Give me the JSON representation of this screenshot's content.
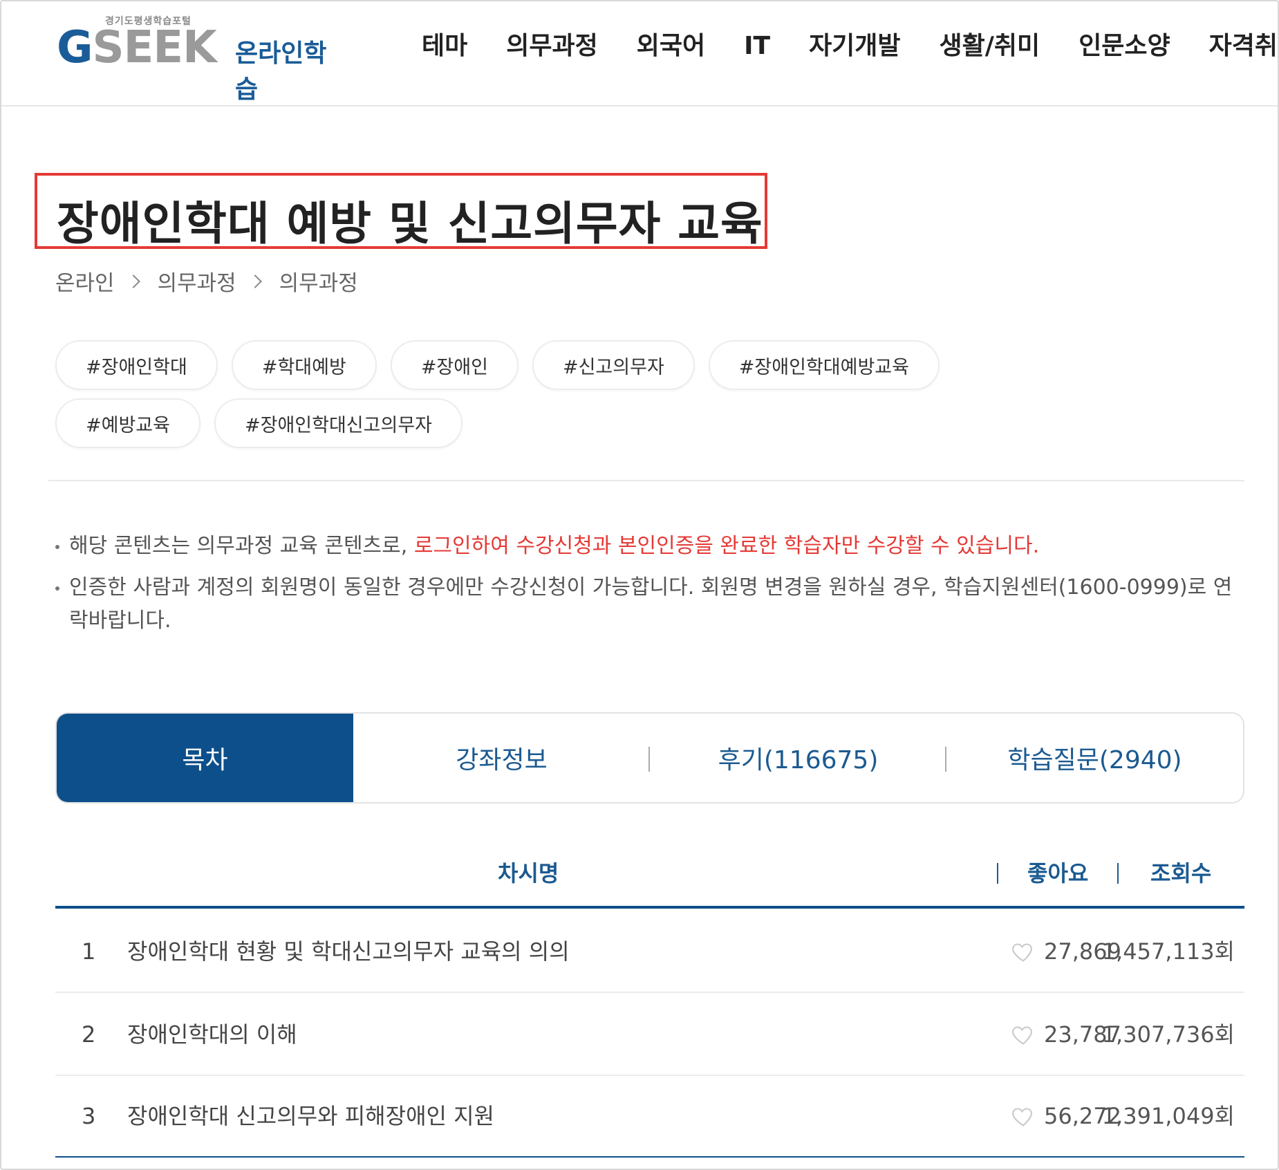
{
  "header": {
    "logo_sub": "경기도평생학습포털",
    "logo_g": "G",
    "logo_rest": "SEEK",
    "logo_online": "온라인학습",
    "nav": [
      "테마",
      "의무과정",
      "외국어",
      "IT",
      "자기개발",
      "생활/취미",
      "인문소양",
      "자격취득"
    ]
  },
  "page": {
    "title": "장애인학대 예방 및 신고의무자 교육",
    "breadcrumb": [
      "온라인",
      "의무과정",
      "의무과정"
    ]
  },
  "tags": [
    "#장애인학대",
    "#학대예방",
    "#장애인",
    "#신고의무자",
    "#장애인학대예방교육",
    "#예방교육",
    "#장애인학대신고의무자"
  ],
  "notices": {
    "first_plain": "해당 콘텐츠는 의무과정 교육 콘텐츠로, ",
    "first_red": "로그인하여 수강신청과 본인인증을 완료한 학습자만 수강할 수 있습니다.",
    "second": "인증한 사람과 계정의 회원명이 동일한 경우에만 수강신청이 가능합니다. 회원명 변경을 원하실 경우, 학습지원센터(1600-0999)로 연락바랍니다."
  },
  "tabs": [
    "목차",
    "강좌정보",
    "후기(116675)",
    "학습질문(2940)"
  ],
  "table": {
    "headers": {
      "title": "차시명",
      "likes": "좋아요",
      "views": "조회수"
    },
    "rows": [
      {
        "num": "1",
        "title": "장애인학대 현황 및 학대신고의무자 교육의 의의",
        "likes": "27,869",
        "views": "1,457,113회"
      },
      {
        "num": "2",
        "title": "장애인학대의 이해",
        "likes": "23,787",
        "views": "1,307,736회"
      },
      {
        "num": "3",
        "title": "장애인학대 신고의무와 피해장애인 지원",
        "likes": "56,272",
        "views": "1,391,049회"
      }
    ]
  },
  "colors": {
    "brand_blue": "#0d4f8a",
    "accent_red": "#e53935"
  }
}
